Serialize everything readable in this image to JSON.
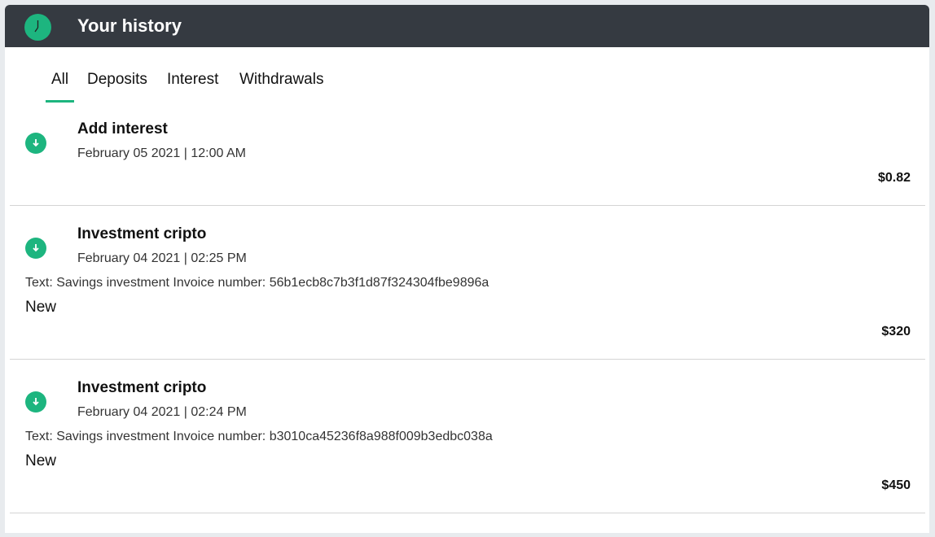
{
  "header": {
    "title": "Your history",
    "icon": "clock-icon",
    "accent": "#1db57f"
  },
  "tabs": [
    {
      "label": "All",
      "active": true
    },
    {
      "label": "Deposits"
    },
    {
      "label": "Interest"
    },
    {
      "label": "Withdrawals"
    }
  ],
  "transactions": [
    {
      "title": "Add interest",
      "date": "February 05 2021 | 12:00 AM",
      "amount": "$0.82",
      "icon": "arrow-down-icon"
    },
    {
      "title": "Investment cripto",
      "date": "February 04 2021 | 02:25 PM",
      "text": "Text: Savings investment Invoice number: 56b1ecb8c7b3f1d87f324304fbe9896a",
      "status": "New",
      "amount": "$320",
      "icon": "arrow-down-icon"
    },
    {
      "title": "Investment cripto",
      "date": "February 04 2021 | 02:24 PM",
      "text": "Text: Savings investment Invoice number: b3010ca45236f8a988f009b3edbc038a",
      "status": "New",
      "amount": "$450",
      "icon": "arrow-down-icon"
    }
  ]
}
